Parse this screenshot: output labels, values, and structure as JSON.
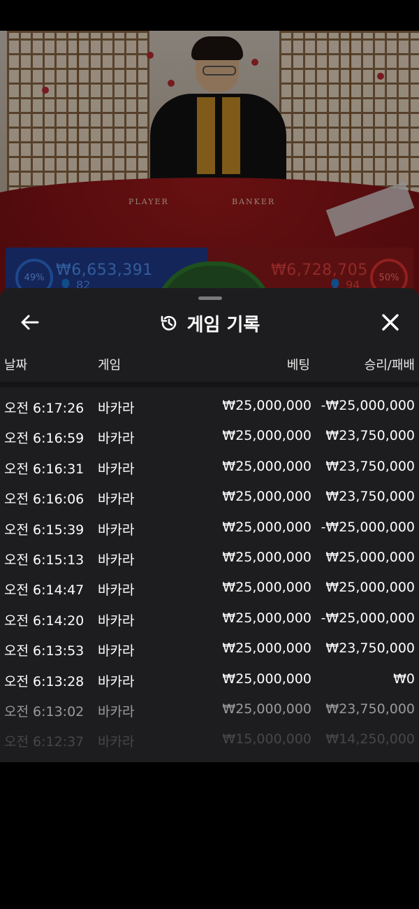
{
  "stream": {
    "table_labels": {
      "player": "PLAYER",
      "banker": "BANKER"
    },
    "player": {
      "percent": "49%",
      "amount": "₩6,653,391",
      "count": "82",
      "color": "#2b6fd6"
    },
    "banker": {
      "percent": "50%",
      "amount": "₩6,728,705",
      "count": "94",
      "color": "#e03030"
    }
  },
  "sheet": {
    "title": "게임 기록",
    "icons": {
      "back": "arrow-left-icon",
      "history": "history-icon",
      "close": "close-icon"
    },
    "columns": {
      "date": "날짜",
      "game": "게임",
      "bet": "베팅",
      "result": "승리/패배"
    },
    "rows": [
      {
        "date": "오전 6:17:26",
        "game": "바카라",
        "bet": "₩25,000,000",
        "result": "-₩25,000,000"
      },
      {
        "date": "오전 6:16:59",
        "game": "바카라",
        "bet": "₩25,000,000",
        "result": "₩23,750,000"
      },
      {
        "date": "오전 6:16:31",
        "game": "바카라",
        "bet": "₩25,000,000",
        "result": "₩23,750,000"
      },
      {
        "date": "오전 6:16:06",
        "game": "바카라",
        "bet": "₩25,000,000",
        "result": "₩23,750,000"
      },
      {
        "date": "오전 6:15:39",
        "game": "바카라",
        "bet": "₩25,000,000",
        "result": "-₩25,000,000"
      },
      {
        "date": "오전 6:15:13",
        "game": "바카라",
        "bet": "₩25,000,000",
        "result": "₩25,000,000"
      },
      {
        "date": "오전 6:14:47",
        "game": "바카라",
        "bet": "₩25,000,000",
        "result": "₩25,000,000"
      },
      {
        "date": "오전 6:14:20",
        "game": "바카라",
        "bet": "₩25,000,000",
        "result": "-₩25,000,000"
      },
      {
        "date": "오전 6:13:53",
        "game": "바카라",
        "bet": "₩25,000,000",
        "result": "₩23,750,000"
      },
      {
        "date": "오전 6:13:28",
        "game": "바카라",
        "bet": "₩25,000,000",
        "result": "₩0"
      },
      {
        "date": "오전 6:13:02",
        "game": "바카라",
        "bet": "₩25,000,000",
        "result": "₩23,750,000"
      },
      {
        "date": "오전 6:12:37",
        "game": "바카라",
        "bet": "₩15,000,000",
        "result": "₩14,250,000"
      }
    ]
  }
}
